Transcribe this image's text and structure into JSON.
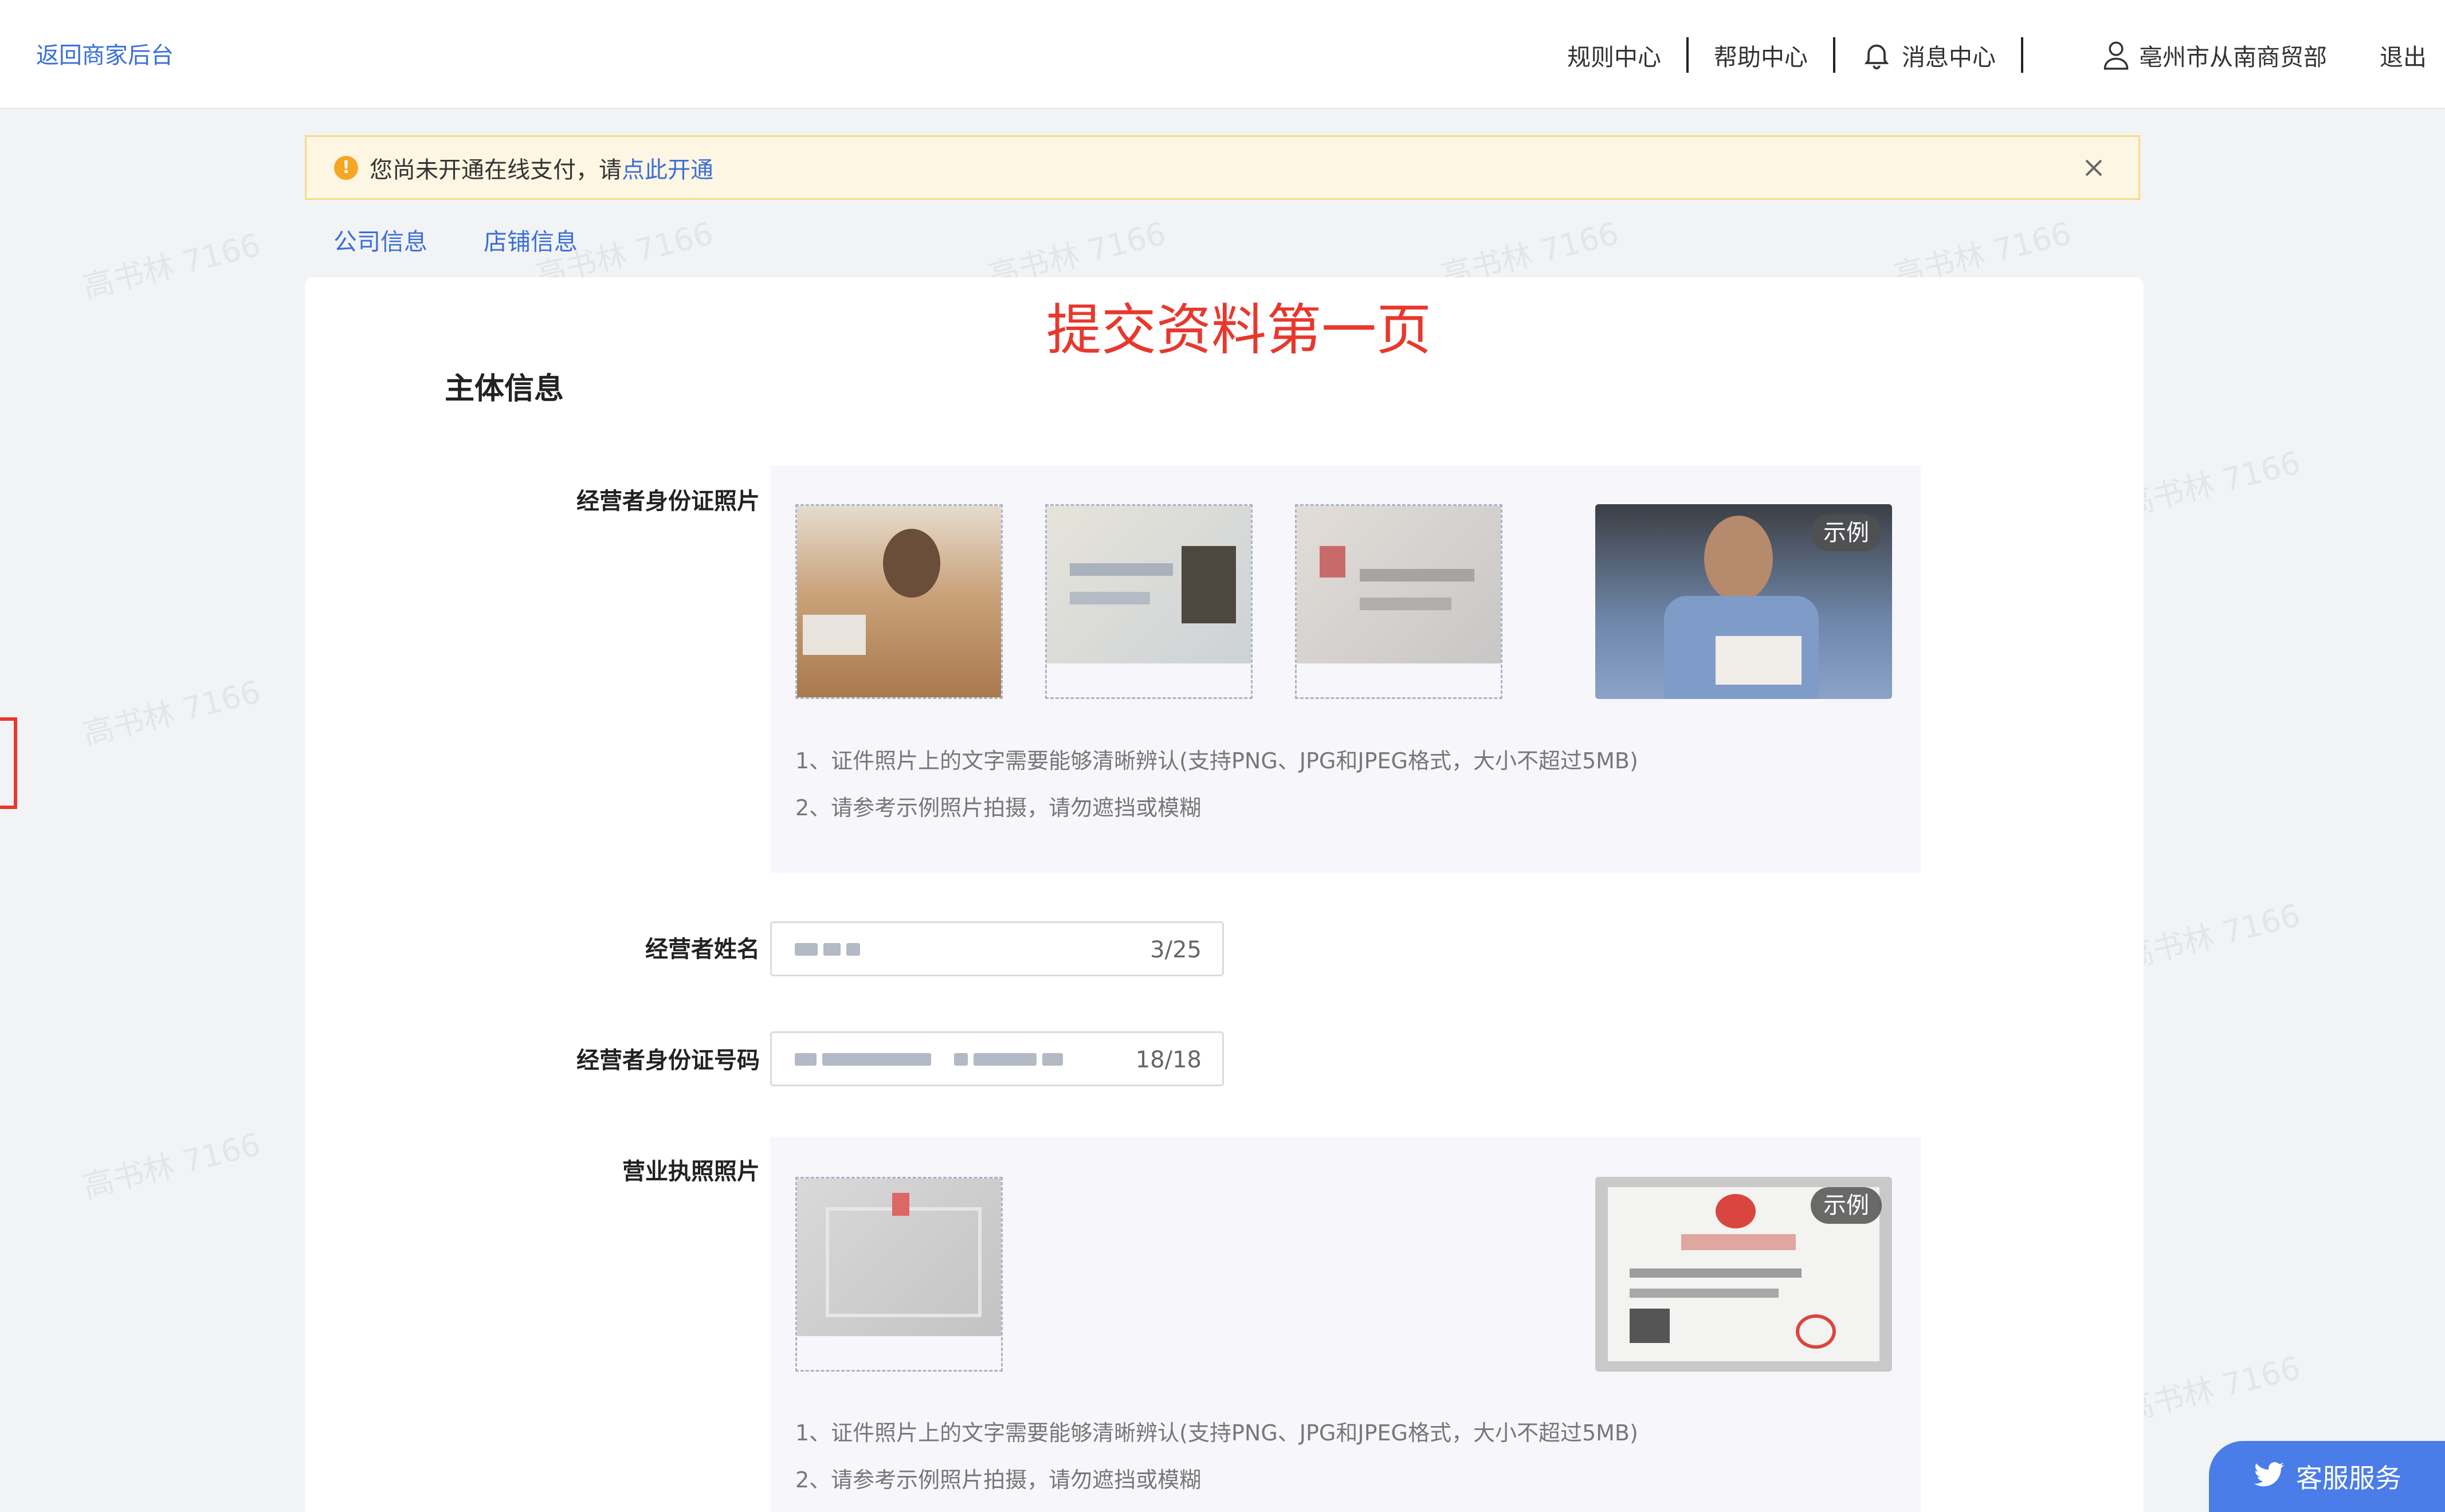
{
  "topbar": {
    "back_label": "返回商家后台",
    "nav": {
      "rules": "规则中心",
      "help": "帮助中心",
      "messages": "消息中心",
      "shop_name": "亳州市从南商贸部",
      "logout": "退出"
    }
  },
  "banner": {
    "text": "您尚未开通在线支付，请",
    "link": "点此开通"
  },
  "tabs": [
    {
      "label": "公司信息"
    },
    {
      "label": "店铺信息"
    }
  ],
  "page": {
    "annotation_title": "提交资料第一页",
    "section_title": "主体信息"
  },
  "fields": {
    "id_photo": {
      "label": "经营者身份证照片",
      "example_badge": "示例",
      "tips": [
        "1、证件照片上的文字需要能够清晰辨认(支持PNG、JPG和JPEG格式，大小不超过5MB)",
        "2、请参考示例照片拍摄，请勿遮挡或模糊"
      ]
    },
    "name": {
      "label": "经营者姓名",
      "counter": "3/25"
    },
    "id_number": {
      "label": "经营者身份证号码",
      "counter": "18/18"
    },
    "license": {
      "label": "营业执照照片",
      "example_badge": "示例",
      "tips": [
        "1、证件照片上的文字需要能够清晰辨认(支持PNG、JPG和JPEG格式，大小不超过5MB)",
        "2、请参考示例照片拍摄，请勿遮挡或模糊"
      ]
    }
  },
  "service": {
    "label": "客服服务"
  },
  "watermark": "高书林 7166",
  "colors": {
    "accent": "#3b6fd8",
    "annotation_red": "#e8382d",
    "banner_bg": "#fdf6e3",
    "service_blue": "#4a7de8"
  }
}
